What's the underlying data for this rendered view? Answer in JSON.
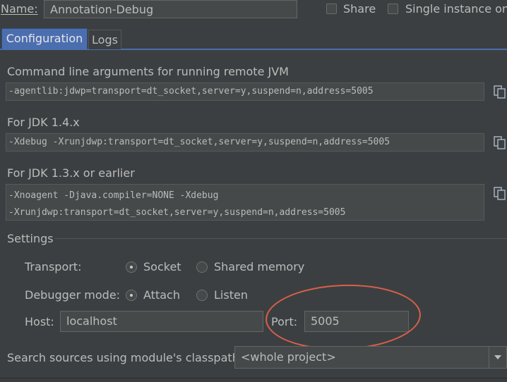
{
  "header": {
    "name_label": "Name:",
    "name_value": "Annotation-Debug",
    "share_label": "Share",
    "single_instance_label": "Single instance only"
  },
  "tabs": [
    {
      "label": "Configuration",
      "active": true
    },
    {
      "label": "Logs",
      "active": false
    }
  ],
  "command_line": {
    "remote_jvm_label": "Command line arguments for running remote JVM",
    "remote_jvm_value": "-agentlib:jdwp=transport=dt_socket,server=y,suspend=n,address=5005",
    "jdk14_label": "For JDK 1.4.x",
    "jdk14_value": "-Xdebug -Xrunjdwp:transport=dt_socket,server=y,suspend=n,address=5005",
    "jdk13_label": "For JDK 1.3.x or earlier",
    "jdk13_line1": "-Xnoagent -Djava.compiler=NONE -Xdebug",
    "jdk13_line2": "-Xrunjdwp:transport=dt_socket,server=y,suspend=n,address=5005",
    "copy_icon": "copy-icon"
  },
  "settings": {
    "title": "Settings",
    "transport_label": "Transport:",
    "transport_options": [
      "Socket",
      "Shared memory"
    ],
    "transport_selected": "Socket",
    "debugger_mode_label": "Debugger mode:",
    "debugger_mode_options": [
      "Attach",
      "Listen"
    ],
    "debugger_mode_selected": "Attach",
    "host_label": "Host:",
    "host_value": "localhost",
    "port_label": "Port:",
    "port_value": "5005"
  },
  "classpath": {
    "label": "Search sources using module's classpath:",
    "value": "<whole project>"
  },
  "colors": {
    "background": "#3c3f41",
    "field": "#45494a",
    "accent": "#4b6eaf",
    "annotation": "#d9604a",
    "text": "#bbbbbb"
  }
}
